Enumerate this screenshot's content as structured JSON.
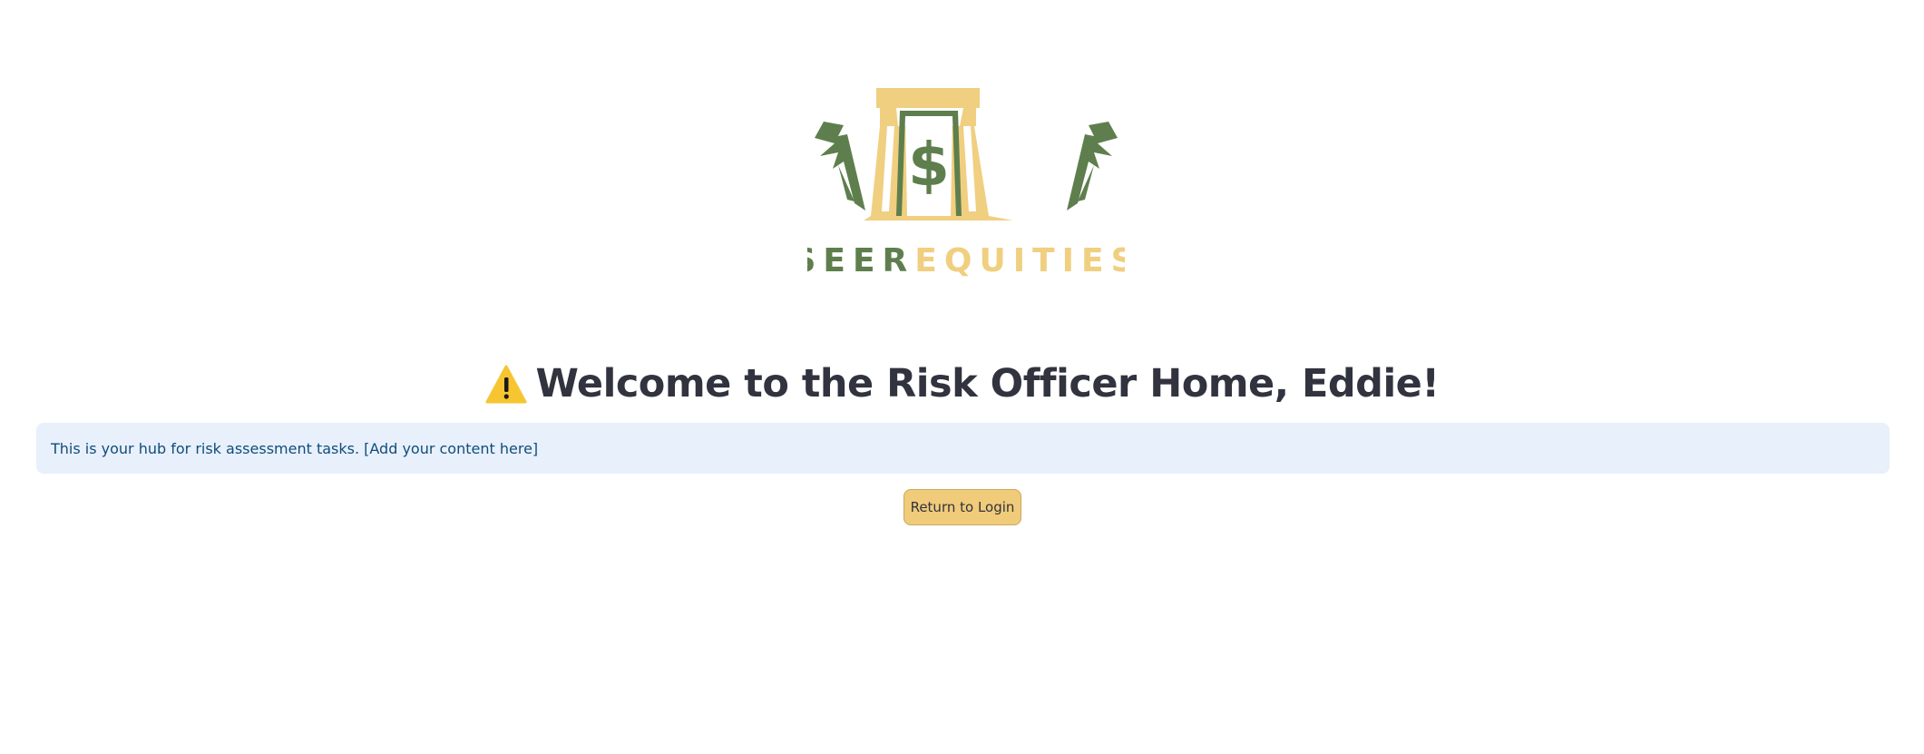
{
  "logo": {
    "text_part1": "SEER",
    "text_part2": "EQUITIES",
    "colors": {
      "green": "#5e7f4d",
      "gold": "#f0cf80"
    }
  },
  "header": {
    "icon": "warning-icon",
    "title": "Welcome to the Risk Officer Home, Eddie!"
  },
  "info": {
    "message": "This is your hub for risk assessment tasks. [Add your content here]"
  },
  "actions": {
    "return_label": "Return to Login"
  },
  "colors": {
    "title_text": "#31333f",
    "info_bg": "#e8f0fb",
    "info_text": "#0f4d7a",
    "button_bg": "#f0cb79"
  }
}
